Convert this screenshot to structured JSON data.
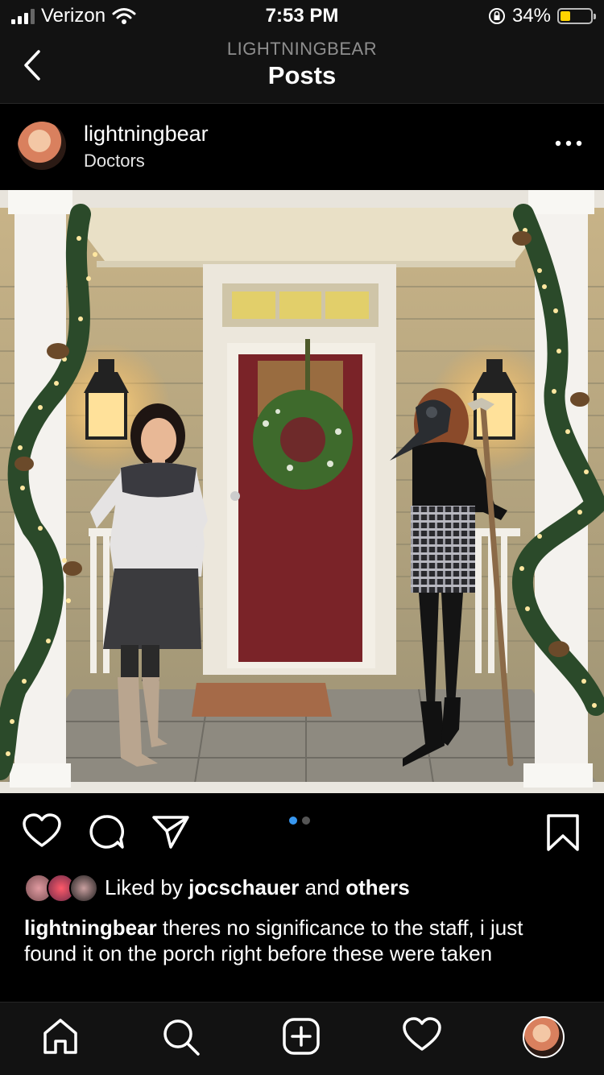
{
  "status_bar": {
    "carrier": "Verizon",
    "time": "7:53 PM",
    "battery_percent": "34%",
    "battery_level": 0.34,
    "icons": [
      "signal-icon",
      "wifi-icon",
      "orientation-lock-icon",
      "battery-icon"
    ]
  },
  "nav": {
    "subtitle": "LIGHTNINGBEAR",
    "title": "Posts",
    "back_icon": "chevron-left-icon"
  },
  "post": {
    "username": "lightningbear",
    "location": "Doctors",
    "more_icon": "more-horizontal-icon",
    "image_count": 2,
    "image_index": 1,
    "likes": {
      "prefix": "Liked by",
      "user": "jocschauer",
      "joiner": "and",
      "others": "others"
    },
    "caption": {
      "username": "lightningbear",
      "text": "theres no significance to the staff, i just found it on the porch right before these were taken"
    }
  },
  "actions": [
    "heart-icon",
    "comment-icon",
    "share-icon",
    "bookmark-icon"
  ],
  "tabs": [
    "home-icon",
    "search-icon",
    "add-post-icon",
    "activity-heart-icon",
    "profile-avatar"
  ],
  "colors": {
    "accent": "#3897f0",
    "battery": "#ffd400",
    "background": "#000000"
  }
}
